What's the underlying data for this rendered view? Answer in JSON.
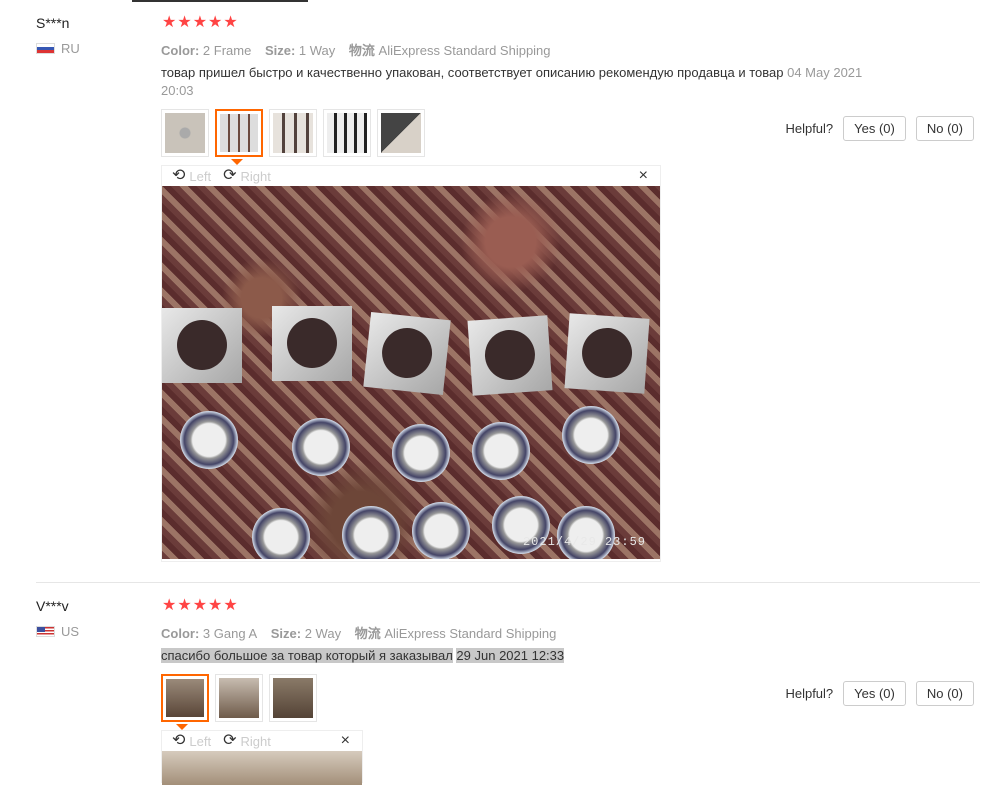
{
  "reviews": [
    {
      "user": "S***n",
      "country": "RU",
      "rating": 5,
      "color_label": "Color:",
      "color_value": "2 Frame",
      "size_label": "Size:",
      "size_value": "1 Way",
      "shipping_label": "物流",
      "shipping_value": "AliExpress Standard Shipping",
      "text": "товар пришел быстро и качественно упакован, соответствует описанию рекомендую продавца и товар",
      "date": "04 May 2021 20:03",
      "helpful_label": "Helpful?",
      "yes_label": "Yes (0)",
      "no_label": "No (0)",
      "viewer": {
        "left_label": "Left",
        "right_label": "Right",
        "close_label": "×",
        "stamp": "2021/4/29  23:59"
      }
    },
    {
      "user": "V***v",
      "country": "US",
      "rating": 5,
      "color_label": "Color:",
      "color_value": "3 Gang A",
      "size_label": "Size:",
      "size_value": "2 Way",
      "shipping_label": "物流",
      "shipping_value": "AliExpress Standard Shipping",
      "text": "спасибо большое за товар который я заказывал",
      "date": "29 Jun 2021 12:33",
      "helpful_label": "Helpful?",
      "yes_label": "Yes (0)",
      "no_label": "No (0)",
      "viewer": {
        "left_label": "Left",
        "right_label": "Right",
        "close_label": "×"
      }
    }
  ],
  "icons": {
    "star": "star-icon",
    "rotate_left": "rotate-left-icon",
    "rotate_right": "rotate-right-icon",
    "close": "close-icon"
  },
  "colors": {
    "star": "#ff4444",
    "active_thumb": "#ff6600"
  }
}
